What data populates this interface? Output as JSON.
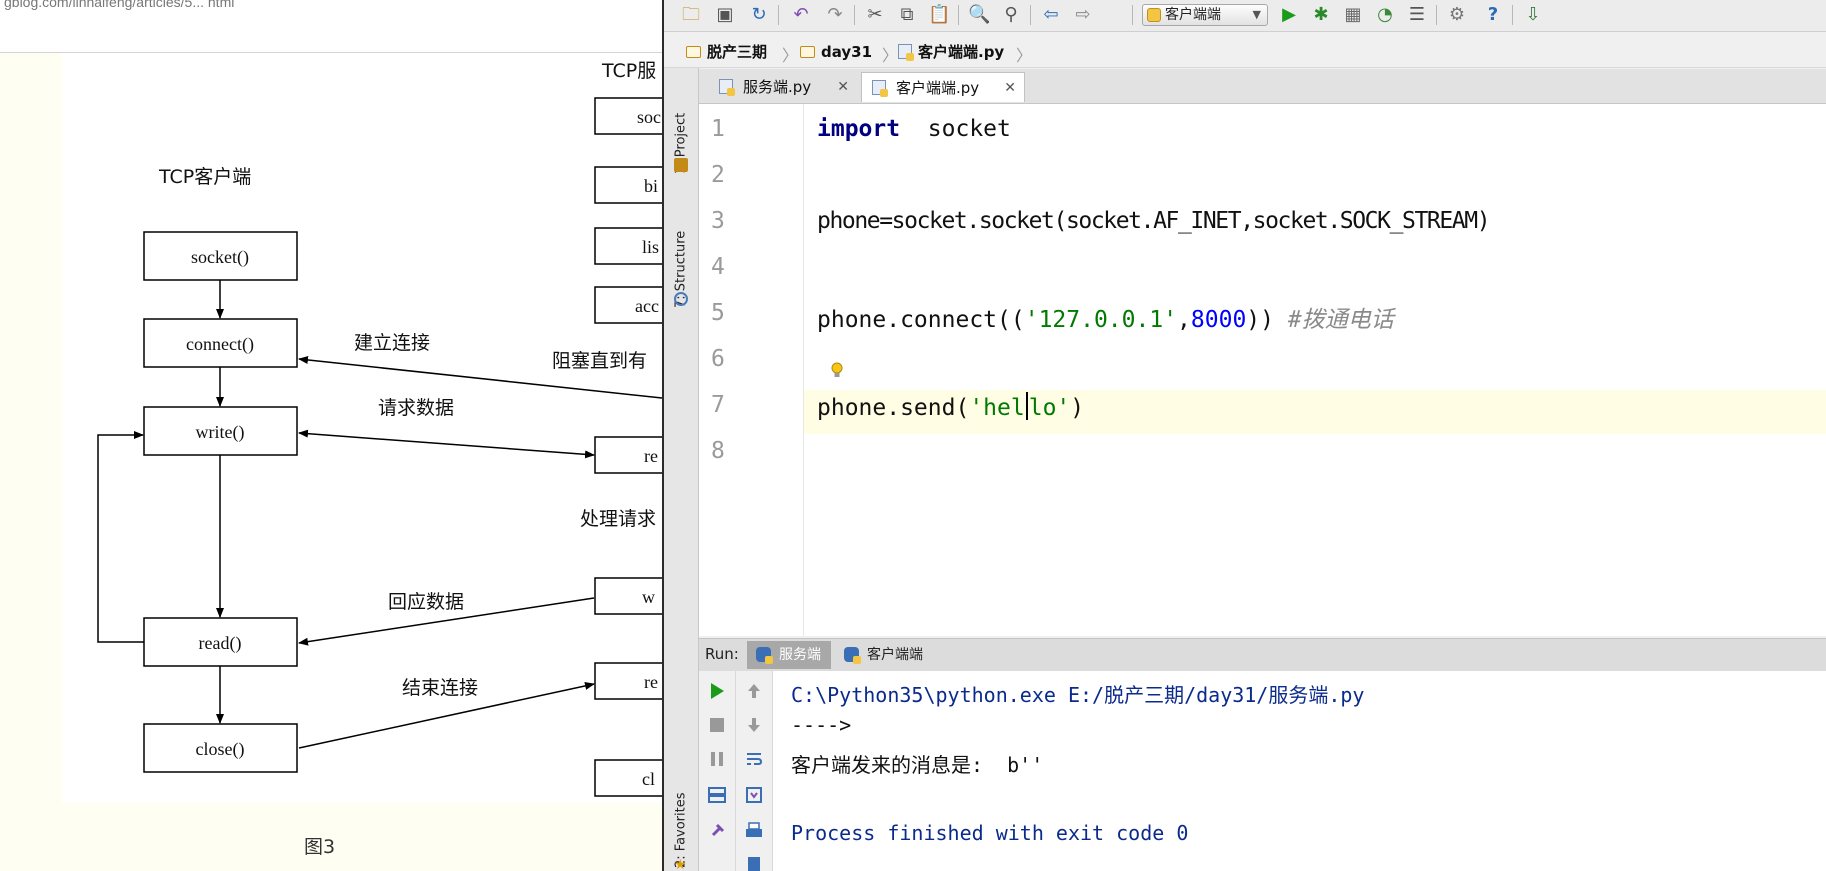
{
  "browser": {
    "url_fragment": "gblog.com/linhaifeng/articles/5... html"
  },
  "diagram": {
    "client_title": "TCP客户端",
    "server_title_partial": "TCP服",
    "client_functions": [
      "socket()",
      "connect()",
      "write()",
      "read()",
      "close()"
    ],
    "server_functions_partial": [
      "soc",
      "bi",
      "lis",
      "acc",
      "re",
      "w",
      "re",
      "cl"
    ],
    "arrow_labels": {
      "establish": "建立连接",
      "request": "请求数据",
      "response": "回应数据",
      "close": "结束连接",
      "block": "阻塞直到有",
      "process": "处理请求"
    },
    "caption": "图3"
  },
  "ide": {
    "run_config": "客户端端",
    "breadcrumb": [
      "脱产三期",
      "day31",
      "客户端端.py"
    ],
    "sidebar_tabs": [
      "1: Project",
      "7: Structure",
      "2: Favorites"
    ],
    "editor_tabs": [
      {
        "label": "服务端.py",
        "active": false
      },
      {
        "label": "客户端端.py",
        "active": true
      }
    ],
    "line_numbers": [
      "1",
      "2",
      "3",
      "4",
      "5",
      "6",
      "7",
      "8"
    ],
    "code": {
      "l1_kw": "import",
      "l1_rest": "  socket",
      "l3": "phone=socket.socket(socket.AF_INET,socket.SOCK_STREAM)",
      "l5_a": "phone.connect((",
      "l5_str": "'127.0.0.1'",
      "l5_b": ",",
      "l5_num": "8000",
      "l5_c": ")) ",
      "l5_cmt": "#拨通电话",
      "l7_a": "phone.send(",
      "l7_str1": "'hel",
      "l7_str2": "lo'",
      "l7_b": ")"
    },
    "run": {
      "label": "Run:",
      "tabs": [
        {
          "label": "服务端",
          "active": true
        },
        {
          "label": "客户端端",
          "active": false
        }
      ]
    },
    "console": {
      "lines": [
        "C:\\Python35\\python.exe E:/脱产三期/day31/服务端.py",
        "---->",
        "客户端发来的消息是:  b''",
        "",
        "Process finished with exit code 0"
      ]
    }
  }
}
